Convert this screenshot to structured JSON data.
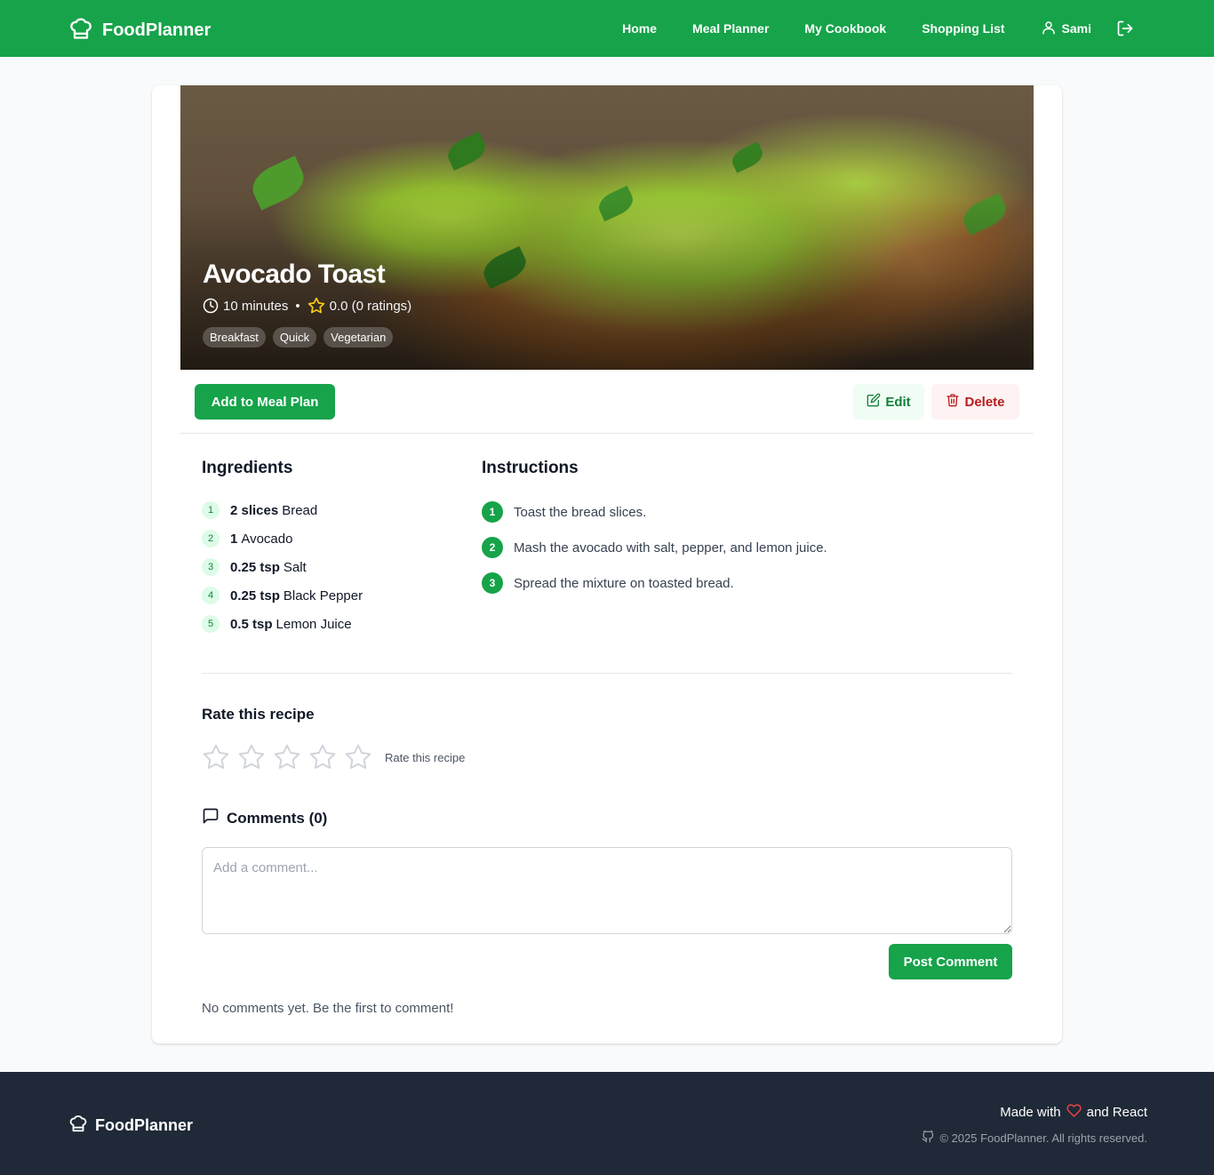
{
  "header": {
    "brand": "FoodPlanner",
    "nav": [
      "Home",
      "Meal Planner",
      "My Cookbook",
      "Shopping List"
    ],
    "user": "Sami"
  },
  "recipe": {
    "title": "Avocado Toast",
    "time": "10 minutes",
    "rating": "0.0 (0 ratings)",
    "tags": [
      "Breakfast",
      "Quick",
      "Vegetarian"
    ]
  },
  "actions": {
    "add_to_meal_plan": "Add to Meal Plan",
    "edit": "Edit",
    "delete": "Delete"
  },
  "ingredients": {
    "title": "Ingredients",
    "items": [
      {
        "num": "1",
        "qty": "2 slices",
        "name": "Bread"
      },
      {
        "num": "2",
        "qty": "1",
        "name": "Avocado"
      },
      {
        "num": "3",
        "qty": "0.25 tsp",
        "name": "Salt"
      },
      {
        "num": "4",
        "qty": "0.25 tsp",
        "name": "Black Pepper"
      },
      {
        "num": "5",
        "qty": "0.5 tsp",
        "name": "Lemon Juice"
      }
    ]
  },
  "instructions": {
    "title": "Instructions",
    "steps": [
      {
        "num": "1",
        "text": "Toast the bread slices."
      },
      {
        "num": "2",
        "text": "Mash the avocado with salt, pepper, and lemon juice."
      },
      {
        "num": "3",
        "text": "Spread the mixture on toasted bread."
      }
    ]
  },
  "rate": {
    "title": "Rate this recipe",
    "hint": "Rate this recipe",
    "current": 0,
    "max": 5
  },
  "comments": {
    "title": "Comments (0)",
    "placeholder": "Add a comment...",
    "post_label": "Post Comment",
    "empty_text": "No comments yet. Be the first to comment!"
  },
  "footer": {
    "brand": "FoodPlanner",
    "made_with_prefix": "Made with",
    "made_with_suffix": "and React",
    "copyright": "© 2025 FoodPlanner. All rights reserved."
  },
  "colors": {
    "primary": "#16a34a",
    "footer_bg": "#1f2937",
    "star_rating": "#facc15",
    "heart": "#ef4444"
  }
}
